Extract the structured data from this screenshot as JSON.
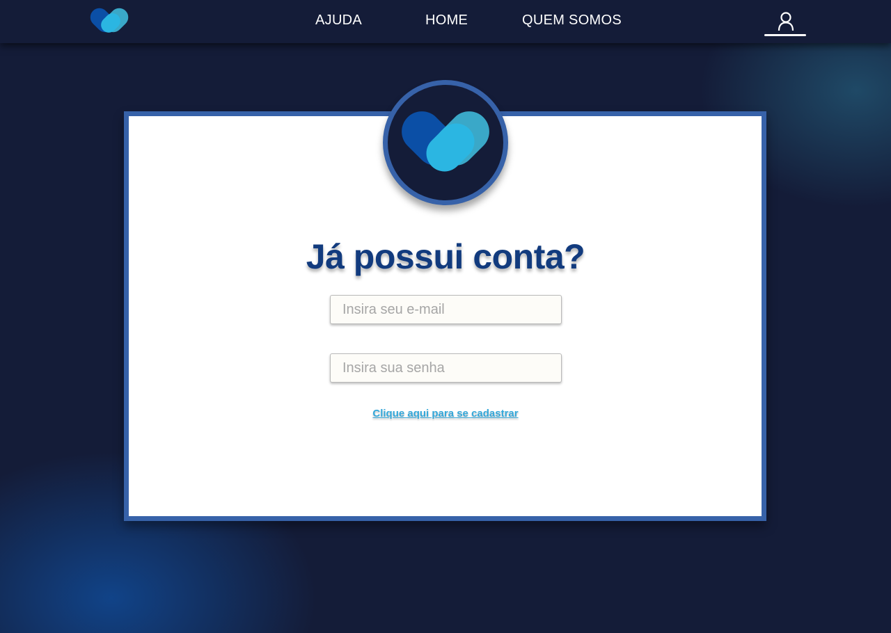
{
  "nav": {
    "logo_icon": "heart-logo-icon",
    "links": [
      "AJUDA",
      "HOME",
      "QUEM SOMOS"
    ],
    "user_icon": "user-icon"
  },
  "login": {
    "badge_icon": "heart-logo-icon",
    "title": "Já possui conta?",
    "email_placeholder": "Insira seu e-mail",
    "password_placeholder": "Insira sua senha",
    "signup_link": "Clique aqui para se cadastrar"
  },
  "colors": {
    "background": "#141c38",
    "card_border": "#3762a9",
    "title": "#123b7e",
    "link": "#34a8da",
    "heart_dark": "#0b4fa6",
    "heart_light": "#2bb6e2",
    "heart_mid": "#3aa8c8"
  }
}
